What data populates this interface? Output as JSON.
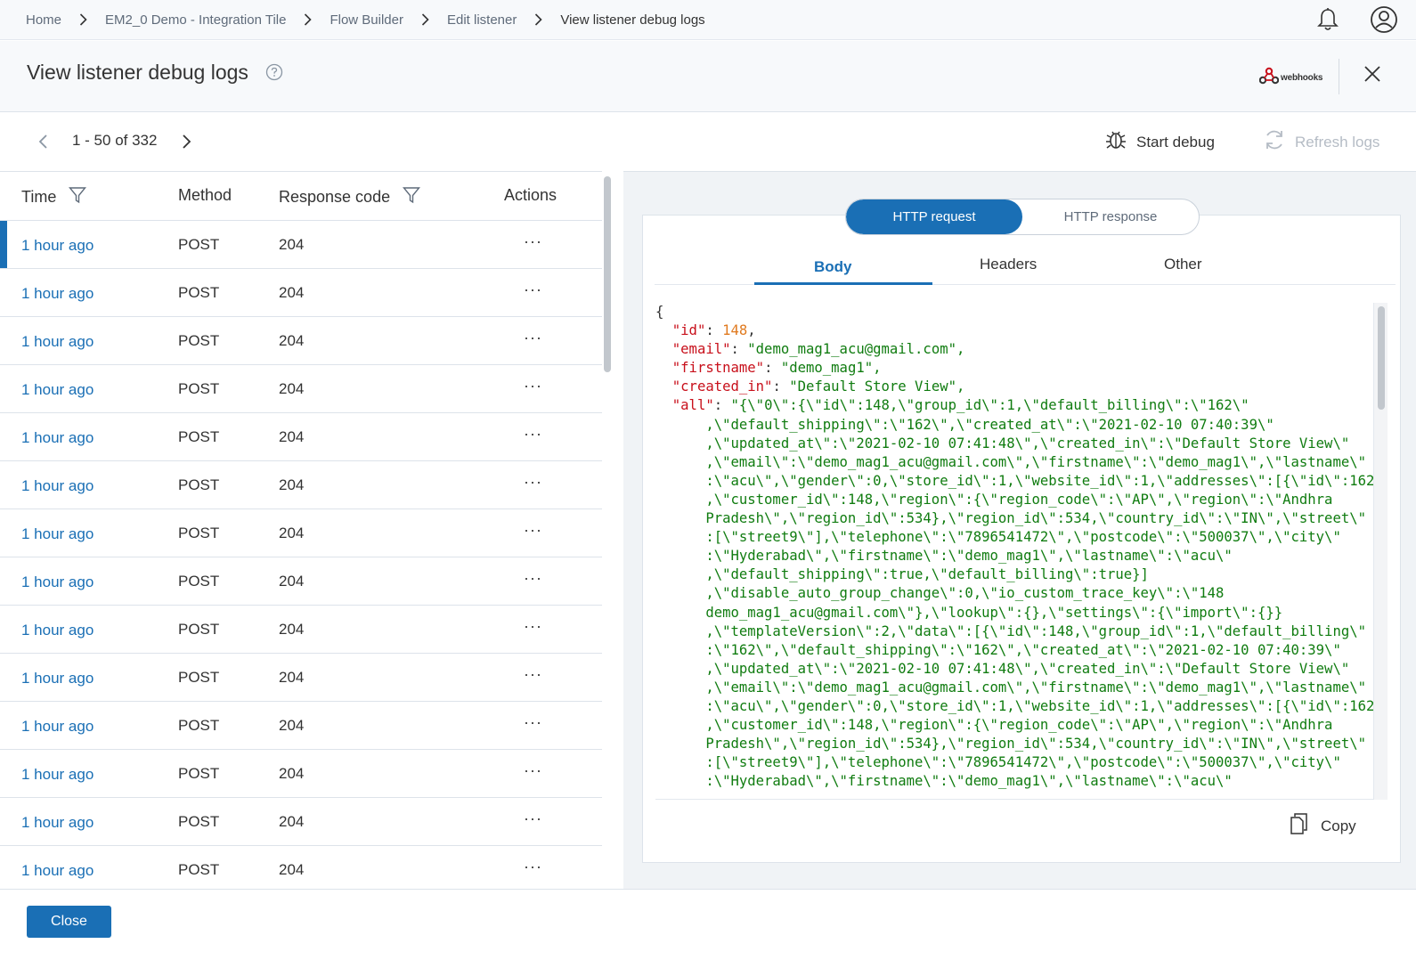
{
  "breadcrumbs": [
    "Home",
    "EM2_0 Demo - Integration Tile",
    "Flow Builder",
    "Edit listener",
    "View listener debug logs"
  ],
  "header": {
    "title": "View listener debug logs",
    "logo_text": "webhooks",
    "help_icon": "question-circle-icon",
    "close_icon": "close-icon"
  },
  "topbar_icons": [
    "bell-icon",
    "user-avatar-icon"
  ],
  "pager": {
    "range_text": "1 - 50 of 332",
    "start_debug_label": "Start debug",
    "refresh_logs_label": "Refresh logs"
  },
  "table": {
    "columns": [
      "Time",
      "Method",
      "Response code",
      "Actions"
    ],
    "rows": [
      {
        "time": "1 hour ago",
        "method": "POST",
        "code": "204",
        "actions": "···"
      },
      {
        "time": "1 hour ago",
        "method": "POST",
        "code": "204",
        "actions": "···"
      },
      {
        "time": "1 hour ago",
        "method": "POST",
        "code": "204",
        "actions": "···"
      },
      {
        "time": "1 hour ago",
        "method": "POST",
        "code": "204",
        "actions": "···"
      },
      {
        "time": "1 hour ago",
        "method": "POST",
        "code": "204",
        "actions": "···"
      },
      {
        "time": "1 hour ago",
        "method": "POST",
        "code": "204",
        "actions": "···"
      },
      {
        "time": "1 hour ago",
        "method": "POST",
        "code": "204",
        "actions": "···"
      },
      {
        "time": "1 hour ago",
        "method": "POST",
        "code": "204",
        "actions": "···"
      },
      {
        "time": "1 hour ago",
        "method": "POST",
        "code": "204",
        "actions": "···"
      },
      {
        "time": "1 hour ago",
        "method": "POST",
        "code": "204",
        "actions": "···"
      },
      {
        "time": "1 hour ago",
        "method": "POST",
        "code": "204",
        "actions": "···"
      },
      {
        "time": "1 hour ago",
        "method": "POST",
        "code": "204",
        "actions": "···"
      },
      {
        "time": "1 hour ago",
        "method": "POST",
        "code": "204",
        "actions": "···"
      },
      {
        "time": "1 hour ago",
        "method": "POST",
        "code": "204",
        "actions": "···"
      }
    ]
  },
  "detail": {
    "toggle": [
      "HTTP request",
      "HTTP response"
    ],
    "tabs": [
      "Body",
      "Headers",
      "Other"
    ],
    "code_lines": [
      "{",
      "  \"id\": 148,",
      "  \"email\": \"demo_mag1_acu@gmail.com\",",
      "  \"firstname\": \"demo_mag1\",",
      "  \"created_in\": \"Default Store View\",",
      "  \"all\": \"{\\\"0\\\":{\\\"id\\\":148,\\\"group_id\\\":1,\\\"default_billing\\\":\\\"162\\\"",
      "      ,\\\"default_shipping\\\":\\\"162\\\",\\\"created_at\\\":\\\"2021-02-10 07:40:39\\\"",
      "      ,\\\"updated_at\\\":\\\"2021-02-10 07:41:48\\\",\\\"created_in\\\":\\\"Default Store View\\\"",
      "      ,\\\"email\\\":\\\"demo_mag1_acu@gmail.com\\\",\\\"firstname\\\":\\\"demo_mag1\\\",\\\"lastname\\\"",
      "      :\\\"acu\\\",\\\"gender\\\":0,\\\"store_id\\\":1,\\\"website_id\\\":1,\\\"addresses\\\":[{\\\"id\\\":162",
      "      ,\\\"customer_id\\\":148,\\\"region\\\":{\\\"region_code\\\":\\\"AP\\\",\\\"region\\\":\\\"Andhra",
      "      Pradesh\\\",\\\"region_id\\\":534},\\\"region_id\\\":534,\\\"country_id\\\":\\\"IN\\\",\\\"street\\\"",
      "      :[\\\"street9\\\"],\\\"telephone\\\":\\\"7896541472\\\",\\\"postcode\\\":\\\"500037\\\",\\\"city\\\"",
      "      :\\\"Hyderabad\\\",\\\"firstname\\\":\\\"demo_mag1\\\",\\\"lastname\\\":\\\"acu\\\"",
      "      ,\\\"default_shipping\\\":true,\\\"default_billing\\\":true}]",
      "      ,\\\"disable_auto_group_change\\\":0,\\\"io_custom_trace_key\\\":\\\"148",
      "      demo_mag1_acu@gmail.com\\\"},\\\"lookup\\\":{},\\\"settings\\\":{\\\"import\\\":{}}",
      "      ,\\\"templateVersion\\\":2,\\\"data\\\":[{\\\"id\\\":148,\\\"group_id\\\":1,\\\"default_billing\\\"",
      "      :\\\"162\\\",\\\"default_shipping\\\":\\\"162\\\",\\\"created_at\\\":\\\"2021-02-10 07:40:39\\\"",
      "      ,\\\"updated_at\\\":\\\"2021-02-10 07:41:48\\\",\\\"created_in\\\":\\\"Default Store View\\\"",
      "      ,\\\"email\\\":\\\"demo_mag1_acu@gmail.com\\\",\\\"firstname\\\":\\\"demo_mag1\\\",\\\"lastname\\\"",
      "      :\\\"acu\\\",\\\"gender\\\":0,\\\"store_id\\\":1,\\\"website_id\\\":1,\\\"addresses\\\":[{\\\"id\\\":162",
      "      ,\\\"customer_id\\\":148,\\\"region\\\":{\\\"region_code\\\":\\\"AP\\\",\\\"region\\\":\\\"Andhra",
      "      Pradesh\\\",\\\"region_id\\\":534},\\\"region_id\\\":534,\\\"country_id\\\":\\\"IN\\\",\\\"street\\\"",
      "      :[\\\"street9\\\"],\\\"telephone\\\":\\\"7896541472\\\",\\\"postcode\\\":\\\"500037\\\",\\\"city\\\"",
      "      :\\\"Hyderabad\\\",\\\"firstname\\\":\\\"demo_mag1\\\",\\\"lastname\\\":\\\"acu\\\""
    ],
    "copy_label": "Copy"
  },
  "footer": {
    "close_label": "Close"
  },
  "colors": {
    "accent": "#1a6fb5",
    "json_key": "#c8101b",
    "json_string": "#107c10",
    "json_number": "#e07a1f"
  }
}
